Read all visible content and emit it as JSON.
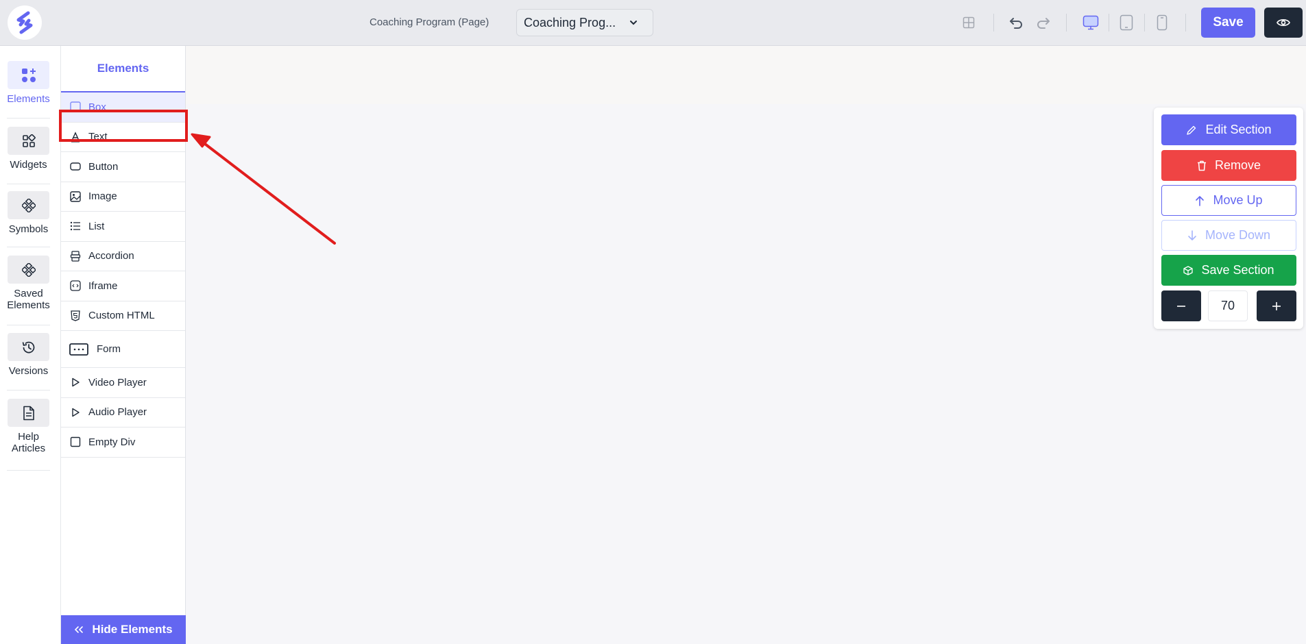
{
  "header": {
    "page_label": "Coaching Program (Page)",
    "page_select": "Coaching Prog...",
    "save_label": "Save"
  },
  "rail": {
    "items": [
      {
        "label": "Elements",
        "icon": "elements-icon",
        "active": true
      },
      {
        "label": "Widgets",
        "icon": "widgets-icon"
      },
      {
        "label": "Symbols",
        "icon": "symbols-icon"
      },
      {
        "label": "Saved Elements",
        "icon": "saved-elements-icon"
      },
      {
        "label": "Versions",
        "icon": "history-icon"
      },
      {
        "label": "Help Articles",
        "icon": "document-icon"
      }
    ]
  },
  "panel": {
    "tab": "Elements",
    "items": [
      {
        "label": "Box",
        "icon": "box-icon",
        "active": true
      },
      {
        "label": "Text",
        "icon": "text-icon"
      },
      {
        "label": "Button",
        "icon": "button-icon"
      },
      {
        "label": "Image",
        "icon": "image-icon"
      },
      {
        "label": "List",
        "icon": "list-icon"
      },
      {
        "label": "Accordion",
        "icon": "accordion-icon"
      },
      {
        "label": "Iframe",
        "icon": "iframe-icon"
      },
      {
        "label": "Custom HTML",
        "icon": "html5-icon"
      },
      {
        "label": "Form",
        "icon": "form-icon"
      },
      {
        "label": "Video Player",
        "icon": "play-icon"
      },
      {
        "label": "Audio Player",
        "icon": "play-icon"
      },
      {
        "label": "Empty Div",
        "icon": "square-icon"
      }
    ],
    "hide_label": "Hide Elements"
  },
  "section_toolbar": {
    "edit": "Edit Section",
    "remove": "Remove",
    "move_up": "Move Up",
    "move_down": "Move Down",
    "save": "Save Section",
    "padding_value": "70"
  },
  "colors": {
    "accent": "#6366f1",
    "danger": "#ef4444",
    "success": "#16a34a",
    "dark": "#1f2937",
    "annotation": "#e11d1d"
  }
}
